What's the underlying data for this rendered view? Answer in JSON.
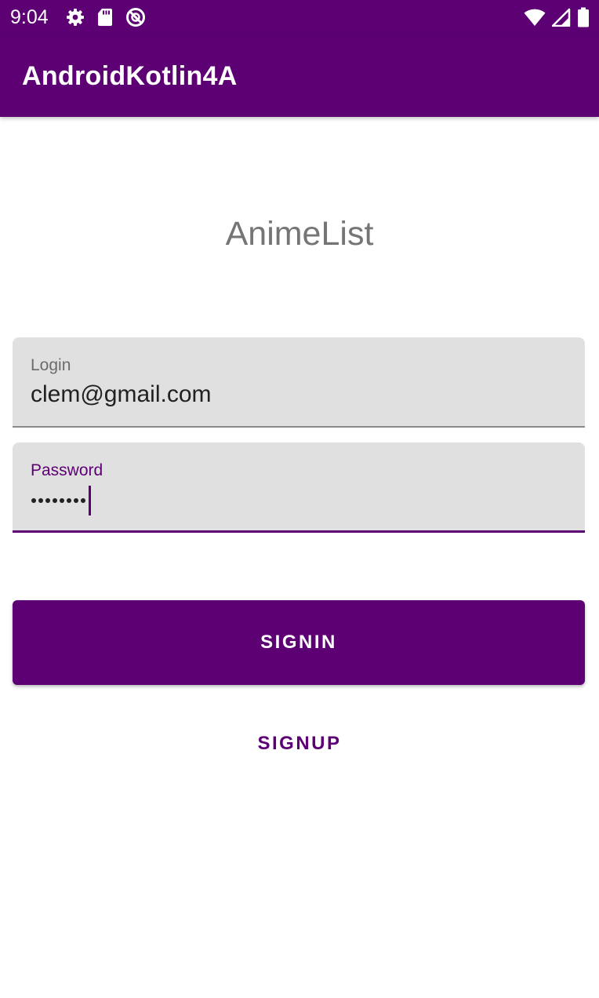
{
  "status_bar": {
    "time": "9:04",
    "left_icons": [
      "settings-icon",
      "sd-card-icon",
      "do-not-disturb-icon"
    ],
    "right_icons": [
      "wifi-icon",
      "cell-signal-icon",
      "battery-icon"
    ]
  },
  "app_bar": {
    "title": "AndroidKotlin4A"
  },
  "main": {
    "headline": "AnimeList",
    "login": {
      "label": "Login",
      "value": "clem@gmail.com"
    },
    "password": {
      "label": "Password",
      "masked_length": 8
    },
    "signin_label": "SIGNIN",
    "signup_label": "SIGNUP"
  },
  "colors": {
    "primary": "#5c0073",
    "field_background": "#e0e0e0",
    "headline_text": "#757575"
  }
}
